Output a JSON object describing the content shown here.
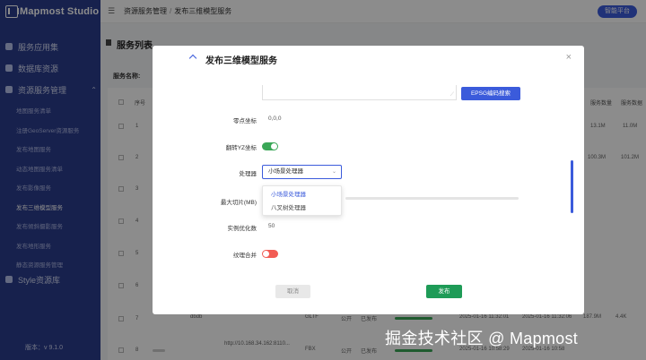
{
  "app": {
    "logo_text": "Mapmost Studio",
    "version": "版本：v 9.1.0"
  },
  "sidebar": {
    "items": [
      {
        "label": "服务应用集",
        "icon": "layers-icon"
      },
      {
        "label": "数据库资源",
        "icon": "database-icon"
      },
      {
        "label": "资源服务管理",
        "icon": "grid-icon",
        "expanded": true
      }
    ],
    "sub_items": [
      {
        "label": "地图服务清单",
        "active": false
      },
      {
        "label": "注册GeoServer资源服务",
        "active": false
      },
      {
        "label": "发布地图服务",
        "active": false
      },
      {
        "label": "动态地图服务清单",
        "active": false
      },
      {
        "label": "发布影像服务",
        "active": false
      },
      {
        "label": "发布三维模型服务",
        "active": true
      },
      {
        "label": "发布倾斜摄影服务",
        "active": false
      },
      {
        "label": "发布地形服务",
        "active": false
      },
      {
        "label": "静态资源服务管理",
        "active": false
      }
    ],
    "style_item": {
      "label": "Style资源库",
      "icon": "palette-icon"
    }
  },
  "topbar": {
    "breadcrumb": [
      "资源服务管理",
      "发布三维模型服务"
    ],
    "platform_button": "智能平台"
  },
  "main": {
    "title": "服务列表",
    "filter_label": "服务名称:",
    "headers": {
      "index": "序号",
      "col_a": "服务数量",
      "col_b": "服务数据"
    },
    "rows": [
      {
        "index": "1",
        "col_a": "13.1M",
        "col_b": "11.0M"
      },
      {
        "index": "2",
        "col_a": "100.3M",
        "col_b": "101.2M"
      },
      {
        "index": "3",
        "col_a": "",
        "col_b": ""
      },
      {
        "index": "4",
        "col_a": "",
        "col_b": ""
      },
      {
        "index": "5",
        "col_a": "",
        "col_b": ""
      },
      {
        "index": "6",
        "col_a": "",
        "col_b": ""
      },
      {
        "index": "7",
        "name": "dbdb",
        "format": "GLTF",
        "access": "公开",
        "status": "已发布",
        "created": "2025-01-16 11:32:01",
        "updated": "2025-01-16 11:32:06",
        "size": "187.9M",
        "data": "4.4K"
      },
      {
        "index": "8",
        "name": "http://10.168.34.162:8110...",
        "format": "FBX",
        "access": "公开",
        "status": "已发布",
        "created": "2025-01-16 10:58:29",
        "updated": "2025-01-16 10:58",
        "size": "",
        "data": ""
      }
    ]
  },
  "modal": {
    "title": "发布三维模型服务",
    "close_label": "×",
    "epsg_button": "EPSG编码搜索",
    "fields": {
      "origin": {
        "label": "零点坐标",
        "value": "0,0,0"
      },
      "flip_yz": {
        "label": "翻转YZ坐标",
        "on": true
      },
      "processor": {
        "label": "处理器",
        "value": "小场景处理器",
        "options": [
          "小场景处理器",
          "八叉树处理器"
        ]
      },
      "max_slice": {
        "label": "最大切片(MB)"
      },
      "instance_opt": {
        "label": "实例优化数",
        "value": "50"
      },
      "texture_merge": {
        "label": "纹理合并",
        "on": false
      }
    },
    "cancel": "取消",
    "publish": "发布"
  },
  "watermark": "掘金技术社区 @ Mapmost",
  "colors": {
    "sidebar": "#2b3c8c",
    "primary": "#3b5bdb",
    "success": "#1e9b57",
    "switch_on": "#3aa757",
    "switch_off": "#f25c54"
  }
}
